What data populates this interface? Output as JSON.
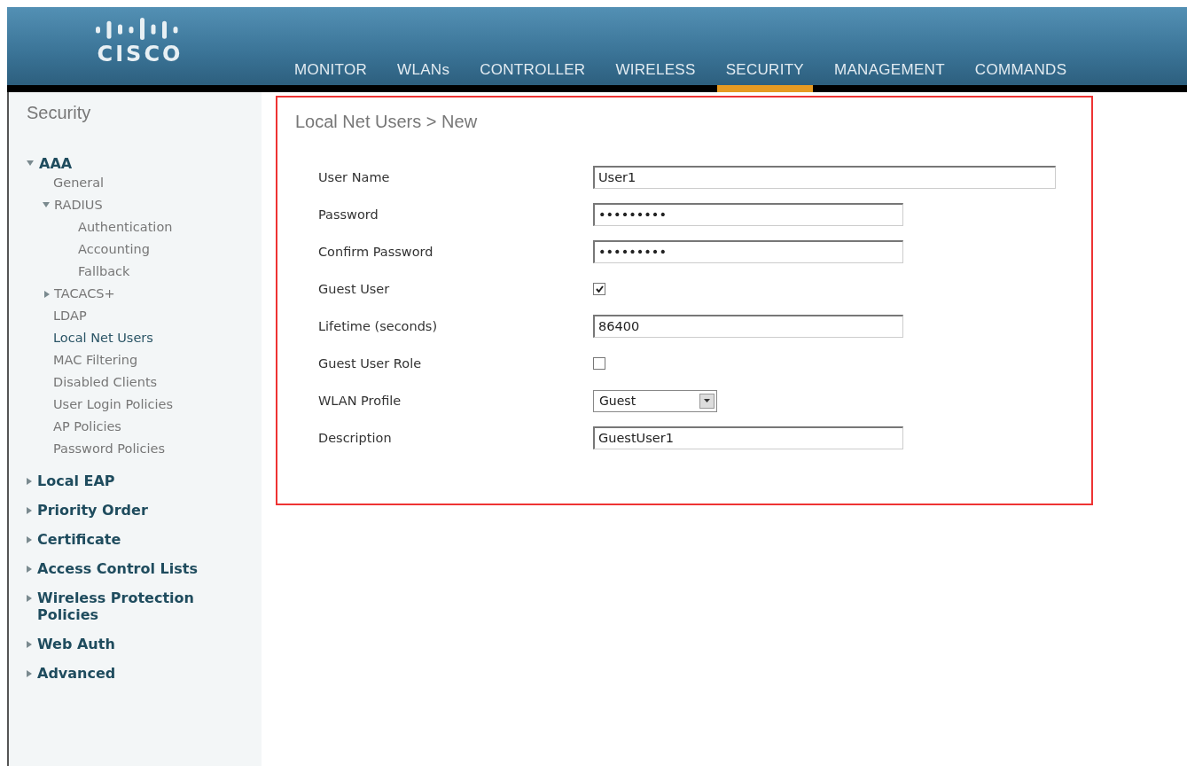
{
  "header": {
    "logo_text": "CISCO",
    "nav": [
      {
        "label": "MONITOR",
        "selected": false
      },
      {
        "label": "WLANs",
        "selected": false
      },
      {
        "label": "CONTROLLER",
        "selected": false
      },
      {
        "label": "WIRELESS",
        "selected": false
      },
      {
        "label": "SECURITY",
        "selected": true
      },
      {
        "label": "MANAGEMENT",
        "selected": false
      },
      {
        "label": "COMMANDS",
        "selected": false
      }
    ]
  },
  "sidebar": {
    "title": "Security",
    "items": [
      {
        "label": "AAA",
        "expanded": true,
        "selected": false,
        "children": [
          {
            "label": "General",
            "selected": false
          },
          {
            "label": "RADIUS",
            "expanded": true,
            "selected": false,
            "children": [
              {
                "label": "Authentication",
                "selected": false
              },
              {
                "label": "Accounting",
                "selected": false
              },
              {
                "label": "Fallback",
                "selected": false
              }
            ]
          },
          {
            "label": "TACACS+",
            "expanded": false,
            "selected": false
          },
          {
            "label": "LDAP",
            "selected": false
          },
          {
            "label": "Local Net Users",
            "selected": true
          },
          {
            "label": "MAC Filtering",
            "selected": false
          },
          {
            "label": "Disabled Clients",
            "selected": false
          },
          {
            "label": "User Login Policies",
            "selected": false
          },
          {
            "label": "AP Policies",
            "selected": false
          },
          {
            "label": "Password Policies",
            "selected": false
          }
        ]
      },
      {
        "label": "Local EAP",
        "expanded": false,
        "selected": false
      },
      {
        "label": "Priority Order",
        "expanded": false,
        "selected": false
      },
      {
        "label": "Certificate",
        "expanded": false,
        "selected": false
      },
      {
        "label": "Access Control Lists",
        "expanded": false,
        "selected": false
      },
      {
        "label": "Wireless Protection Policies",
        "expanded": false,
        "selected": false
      },
      {
        "label": "Web Auth",
        "expanded": false,
        "selected": false
      },
      {
        "label": "Advanced",
        "expanded": false,
        "selected": false
      }
    ]
  },
  "form": {
    "title": "Local Net Users > New",
    "fields": [
      {
        "kind": "text",
        "label": "User Name",
        "value": "User1",
        "wide": true
      },
      {
        "kind": "password",
        "label": "Password",
        "value": "•••••••••"
      },
      {
        "kind": "password",
        "label": "Confirm Password",
        "value": "•••••••••"
      },
      {
        "kind": "checkbox",
        "label": "Guest User",
        "checked": true
      },
      {
        "kind": "text",
        "label": "Lifetime (seconds)",
        "value": "86400"
      },
      {
        "kind": "checkbox",
        "label": "Guest User Role",
        "checked": false
      },
      {
        "kind": "select",
        "label": "WLAN Profile",
        "value": "Guest"
      },
      {
        "kind": "text",
        "label": "Description",
        "value": "GuestUser1"
      }
    ]
  }
}
